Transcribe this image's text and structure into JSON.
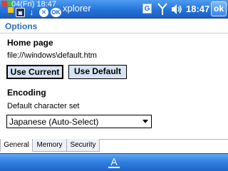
{
  "statusbar": {
    "clock_line": "04(Fri) 18:47",
    "app_title_fragment": "xplorer",
    "time": "18:47",
    "ok_label": "ok",
    "g_label": "G",
    "notify_ok_label": "OK",
    "notify_close_label": "✕",
    "notify_down_label": "↓",
    "notify_cam_label": "◙"
  },
  "page": {
    "title": "Options"
  },
  "home_page": {
    "heading": "Home page",
    "url": "file://\\windows\\default.htm",
    "use_current_label": "Use Current",
    "use_default_label": "Use Default"
  },
  "encoding": {
    "heading": "Encoding",
    "charset_label": "Default character set",
    "selected_charset": "Japanese (Auto-Select)"
  },
  "tabs": [
    {
      "label": "General",
      "active": true
    },
    {
      "label": "Memory",
      "active": false
    },
    {
      "label": "Security",
      "active": false
    }
  ],
  "bottombar": {
    "keyboard_glyph": "A"
  },
  "colors": {
    "titlebar": "#2473d8",
    "page_title": "#2d6fbe",
    "button_face": "#d7e3f4"
  }
}
